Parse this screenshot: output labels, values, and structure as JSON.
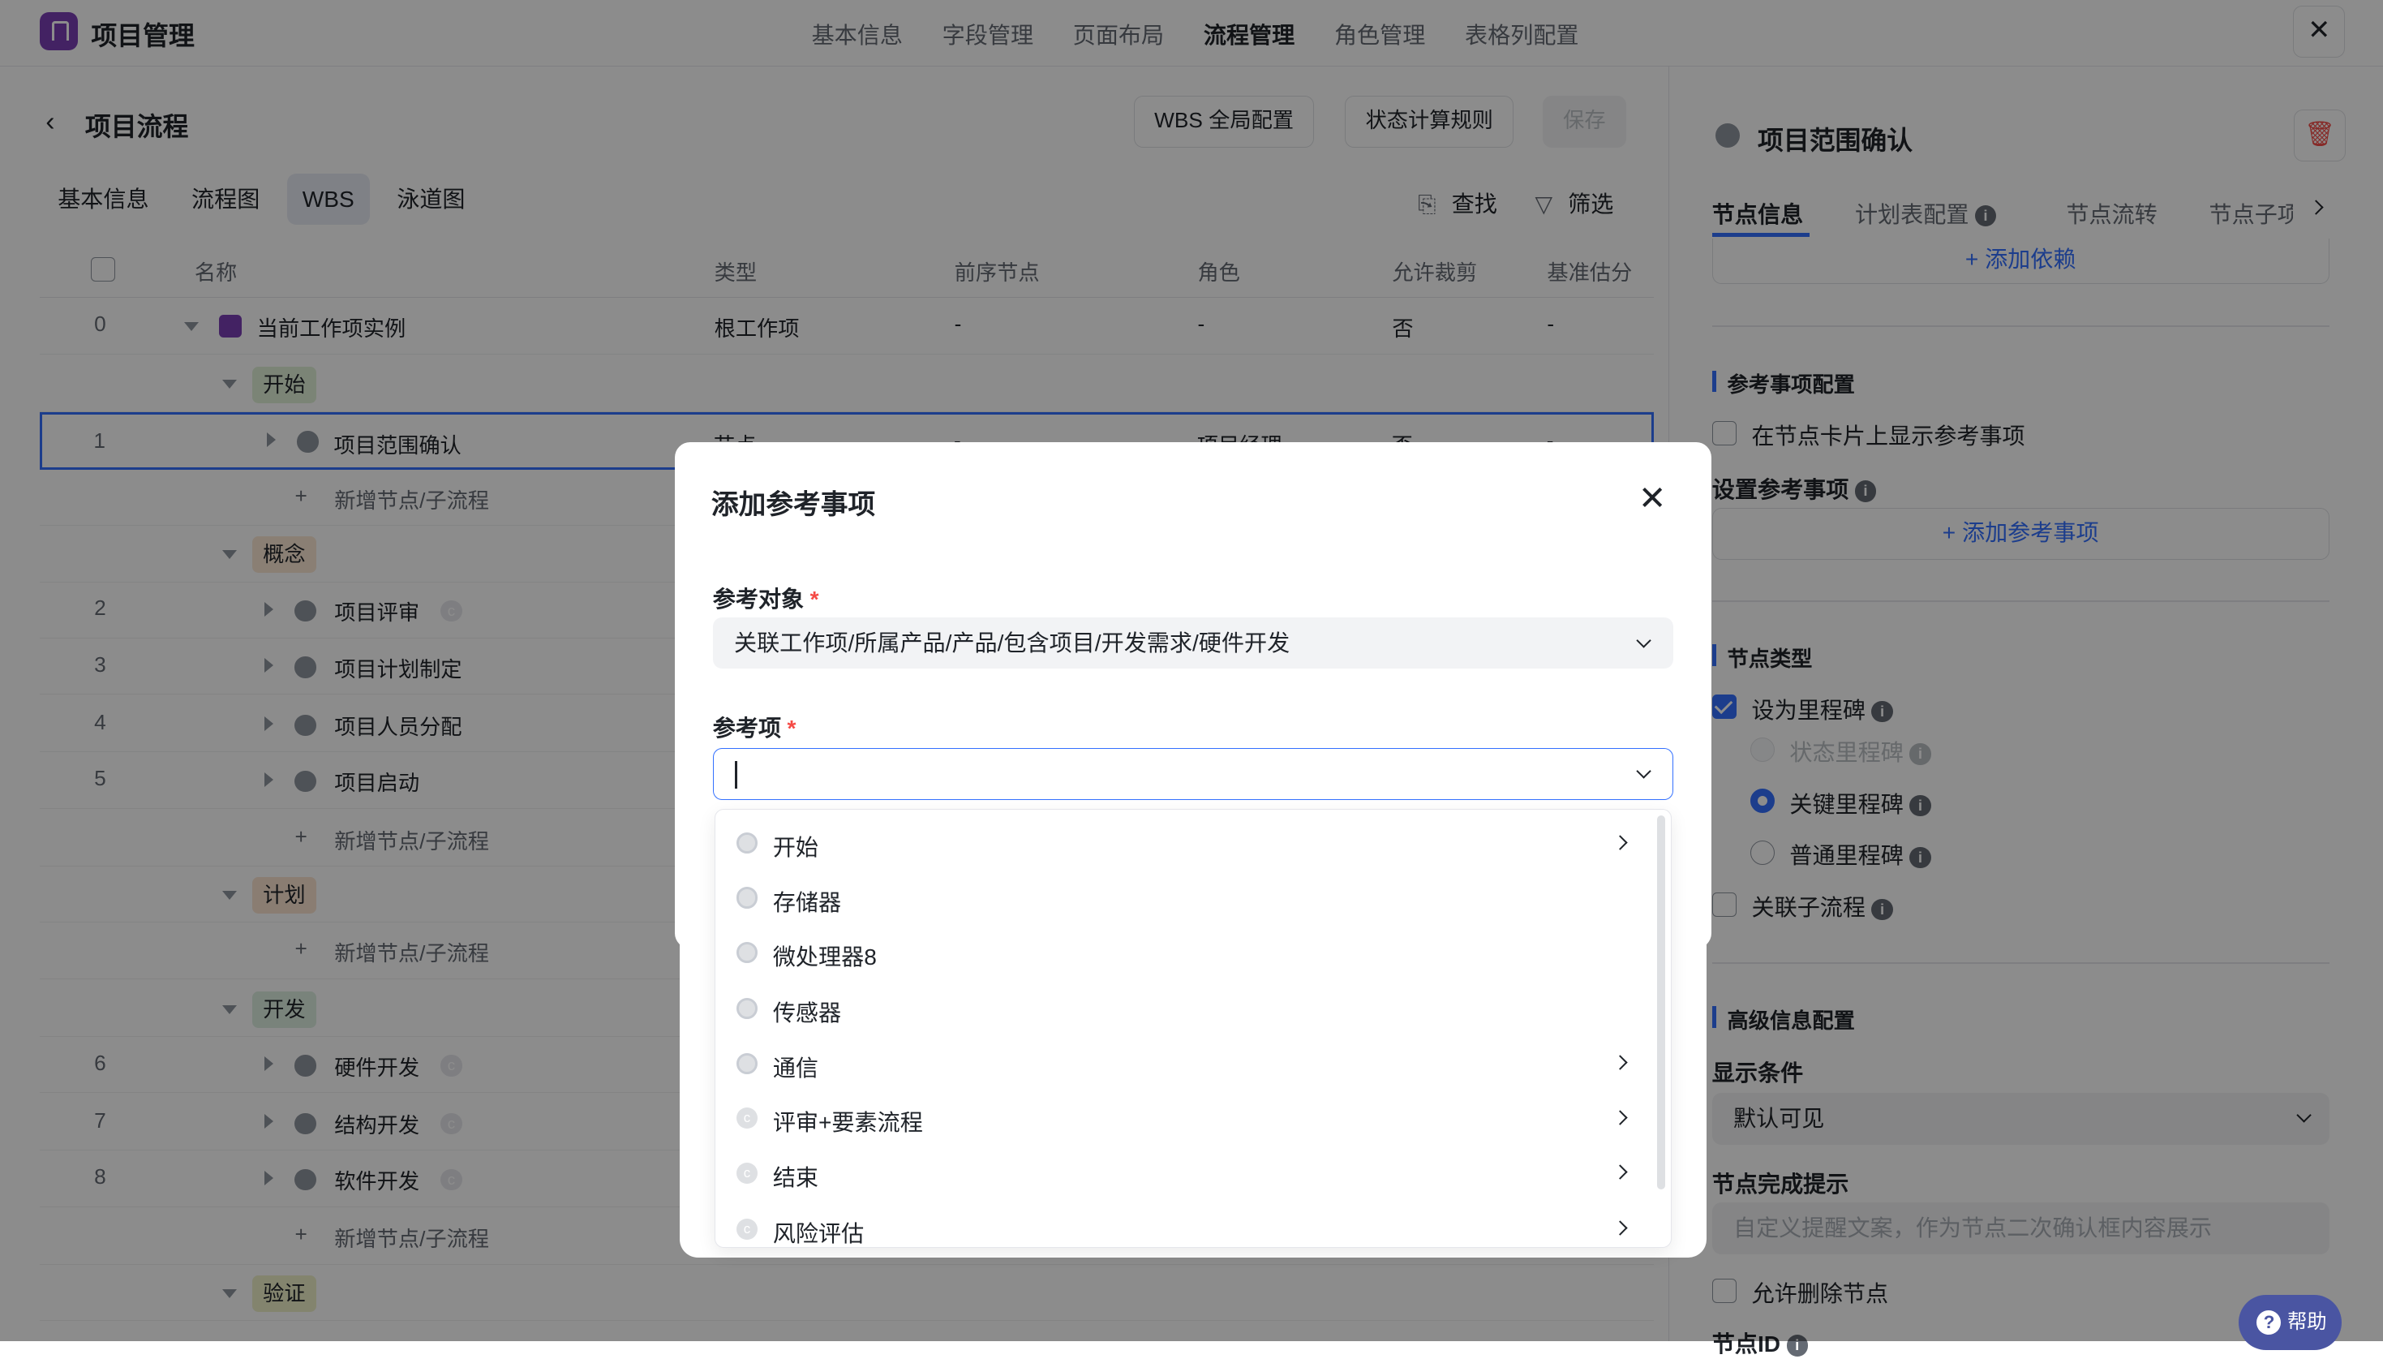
{
  "app": {
    "title": "项目管理"
  },
  "topnav": [
    "基本信息",
    "字段管理",
    "页面布局",
    "流程管理",
    "角色管理",
    "表格列配置"
  ],
  "topnav_active": "流程管理",
  "page": {
    "title": "项目流程",
    "buttons": {
      "wbs_global": "WBS 全局配置",
      "status_rule": "状态计算规则",
      "save": "保存"
    }
  },
  "tabs": [
    "基本信息",
    "流程图",
    "WBS",
    "泳道图"
  ],
  "tools": {
    "find": "查找",
    "filter": "筛选"
  },
  "table": {
    "headers": [
      "名称",
      "类型",
      "前序节点",
      "角色",
      "允许裁剪",
      "基准估分"
    ],
    "root": {
      "num": "0",
      "name": "当前工作项实例",
      "type": "根工作项",
      "prev": "-",
      "role": "-",
      "cut": "否",
      "est": "-"
    },
    "selected": {
      "num": "1",
      "name": "项目范围确认",
      "type": "节点",
      "prev": "-",
      "role": "项目经理",
      "cut": "否",
      "est": "-"
    },
    "phases": {
      "start": "开始",
      "concept": "概念",
      "plan": "计划",
      "dev": "开发",
      "verify": "验证"
    },
    "add_node": "新增节点/子流程",
    "rows": [
      {
        "num": "2",
        "name": "项目评审"
      },
      {
        "num": "3",
        "name": "项目计划制定"
      },
      {
        "num": "4",
        "name": "项目人员分配"
      },
      {
        "num": "5",
        "name": "项目启动"
      },
      {
        "num": "6",
        "name": "硬件开发"
      },
      {
        "num": "7",
        "name": "结构开发"
      },
      {
        "num": "8",
        "name": "软件开发"
      }
    ]
  },
  "panel": {
    "title": "项目范围确认",
    "tabs": [
      "节点信息",
      "计划表配置",
      "节点流转",
      "节点子项"
    ],
    "add_dependency": "添加依赖",
    "ref_config": {
      "title": "参考事项配置",
      "show_on_card": "在节点卡片上显示参考事项",
      "set_ref": "设置参考事项",
      "add_ref": "添加参考事项"
    },
    "node_type": {
      "title": "节点类型",
      "milestone": "设为里程碑",
      "status_milestone": "状态里程碑",
      "key_milestone": "关键里程碑",
      "normal_milestone": "普通里程碑",
      "link_subflow": "关联子流程"
    },
    "advanced": {
      "title": "高级信息配置",
      "display_cond_label": "显示条件",
      "display_cond_value": "默认可见",
      "complete_tip_label": "节点完成提示",
      "complete_tip_placeholder": "自定义提醒文案，作为节点二次确认框内容展示",
      "allow_delete": "允许删除节点",
      "node_id": "节点ID"
    }
  },
  "modal": {
    "title": "添加参考事项",
    "ref_object_label": "参考对象",
    "ref_object_value": "关联工作项/所属产品/产品/包含项目/开发需求/硬件开发",
    "ref_item_label": "参考项",
    "ref_item_value": "",
    "options": [
      {
        "label": "开始",
        "icon": "circle",
        "has_children": true
      },
      {
        "label": "存储器",
        "icon": "circle",
        "has_children": false
      },
      {
        "label": "微处理器8",
        "icon": "circle",
        "has_children": false
      },
      {
        "label": "传感器",
        "icon": "circle",
        "has_children": false
      },
      {
        "label": "通信",
        "icon": "circle",
        "has_children": true
      },
      {
        "label": "评审+要素流程",
        "icon": "c-badge",
        "has_children": true
      },
      {
        "label": "结束",
        "icon": "c-badge",
        "has_children": true
      },
      {
        "label": "风险评估",
        "icon": "c-badge",
        "has_children": true
      }
    ]
  },
  "help": "帮助",
  "colors": {
    "accent": "#3370ff",
    "brand": "#7b3fb5",
    "phase_start": "#e1f1d8",
    "phase_concept": "#fbe8d3",
    "phase_plan": "#fbe3d0",
    "phase_dev": "#dcefe0",
    "phase_verify": "#eef0c8"
  }
}
